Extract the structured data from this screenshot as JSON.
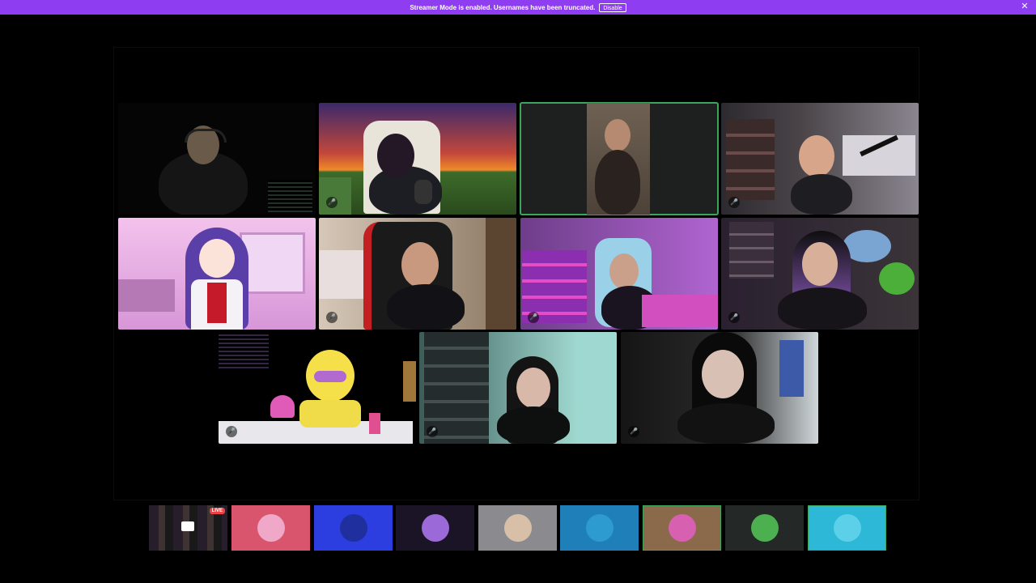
{
  "banner": {
    "message": "Streamer Mode is enabled. Usernames have been truncated.",
    "disable_label": "Disable",
    "close_glyph": "✕"
  },
  "tiles": {
    "mute_glyph": "🎤"
  },
  "bottom_strip": {
    "live_label": "LIVE"
  },
  "colors": {
    "banner": "#8f3df0",
    "speaking_outline": "#3ba55d",
    "live_badge": "#ed4245"
  }
}
